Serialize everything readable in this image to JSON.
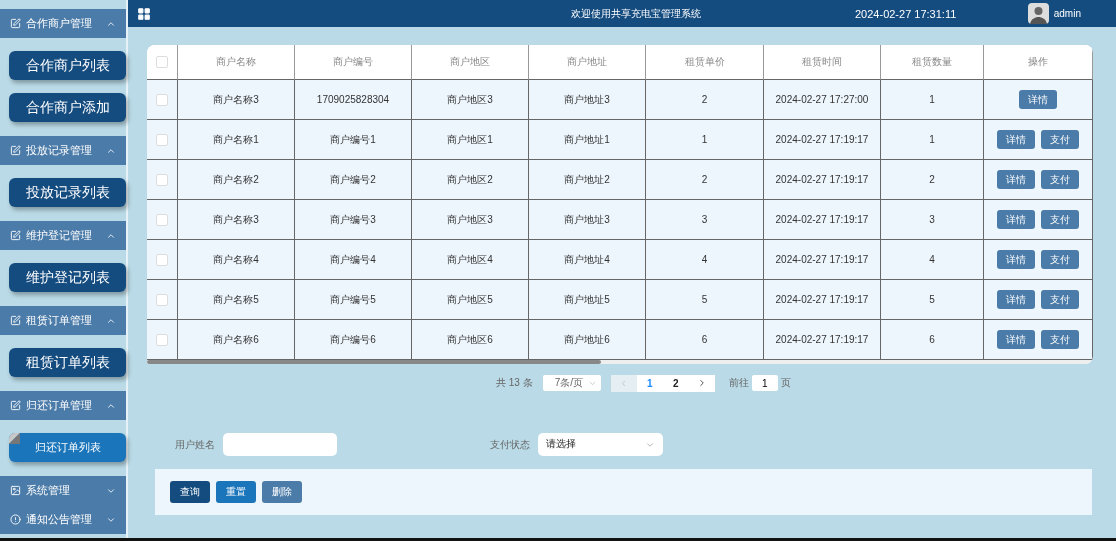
{
  "sidebar": {
    "groups": [
      {
        "label": "合作商户管理",
        "kind": "module",
        "expanded": true,
        "children": [
          {
            "label": "合作商户列表",
            "selected": false
          },
          {
            "label": "合作商户添加",
            "selected": false
          }
        ]
      },
      {
        "label": "投放记录管理",
        "kind": "module",
        "expanded": true,
        "children": [
          {
            "label": "投放记录列表",
            "selected": false
          }
        ]
      },
      {
        "label": "维护登记管理",
        "kind": "module",
        "expanded": true,
        "children": [
          {
            "label": "维护登记列表",
            "selected": false
          }
        ]
      },
      {
        "label": "租赁订单管理",
        "kind": "module",
        "expanded": true,
        "children": [
          {
            "label": "租赁订单列表",
            "selected": false
          }
        ]
      },
      {
        "label": "归还订单管理",
        "kind": "module",
        "expanded": true,
        "children": [
          {
            "label": "归还订单列表",
            "selected": true
          }
        ]
      },
      {
        "label": "系统管理",
        "kind": "system",
        "expanded": false
      },
      {
        "label": "通知公告管理",
        "kind": "notice",
        "expanded": false
      }
    ]
  },
  "header": {
    "title": "欢迎使用共享充电宝管理系统",
    "datetime": "2024-02-27 17:31:11",
    "user": "admin"
  },
  "table": {
    "all_checked": false,
    "columns": [
      "商户名称",
      "商户编号",
      "商户地区",
      "商户地址",
      "租赁单价",
      "租赁时间",
      "租赁数量",
      "操作"
    ],
    "rows": [
      {
        "checked": false,
        "cells": [
          "商户名称3",
          "1709025828304",
          "商户地区3",
          "商户地址3",
          "2",
          "2024-02-27 17:27:00",
          "1"
        ],
        "actions": [
          "详情"
        ]
      },
      {
        "checked": false,
        "cells": [
          "商户名称1",
          "商户编号1",
          "商户地区1",
          "商户地址1",
          "1",
          "2024-02-27 17:19:17",
          "1"
        ],
        "actions": [
          "详情",
          "支付"
        ]
      },
      {
        "checked": false,
        "cells": [
          "商户名称2",
          "商户编号2",
          "商户地区2",
          "商户地址2",
          "2",
          "2024-02-27 17:19:17",
          "2"
        ],
        "actions": [
          "详情",
          "支付"
        ]
      },
      {
        "checked": false,
        "cells": [
          "商户名称3",
          "商户编号3",
          "商户地区3",
          "商户地址3",
          "3",
          "2024-02-27 17:19:17",
          "3"
        ],
        "actions": [
          "详情",
          "支付"
        ]
      },
      {
        "checked": false,
        "cells": [
          "商户名称4",
          "商户编号4",
          "商户地区4",
          "商户地址4",
          "4",
          "2024-02-27 17:19:17",
          "4"
        ],
        "actions": [
          "详情",
          "支付"
        ]
      },
      {
        "checked": false,
        "cells": [
          "商户名称5",
          "商户编号5",
          "商户地区5",
          "商户地址5",
          "5",
          "2024-02-27 17:19:17",
          "5"
        ],
        "actions": [
          "详情",
          "支付"
        ]
      },
      {
        "checked": false,
        "cells": [
          "商户名称6",
          "商户编号6",
          "商户地区6",
          "商户地址6",
          "6",
          "2024-02-27 17:19:17",
          "6"
        ],
        "actions": [
          "详情",
          "支付"
        ]
      }
    ]
  },
  "pagination": {
    "total": "共 13 条",
    "page_size": "7条/页",
    "pages": [
      {
        "label": "1",
        "selected": true
      },
      {
        "label": "2",
        "selected": false
      }
    ],
    "goto_label": "前往",
    "goto_value": "1",
    "goto_suffix": "页"
  },
  "search": {
    "fields": [
      {
        "kind": "input",
        "label": "用户姓名"
      },
      {
        "kind": "select",
        "label": "支付状态",
        "value": "请选择"
      }
    ],
    "buttons": [
      {
        "label": "查询",
        "kind": "primary"
      },
      {
        "label": "重置",
        "kind": "secondary"
      },
      {
        "label": "删除",
        "kind": "danger"
      }
    ]
  }
}
